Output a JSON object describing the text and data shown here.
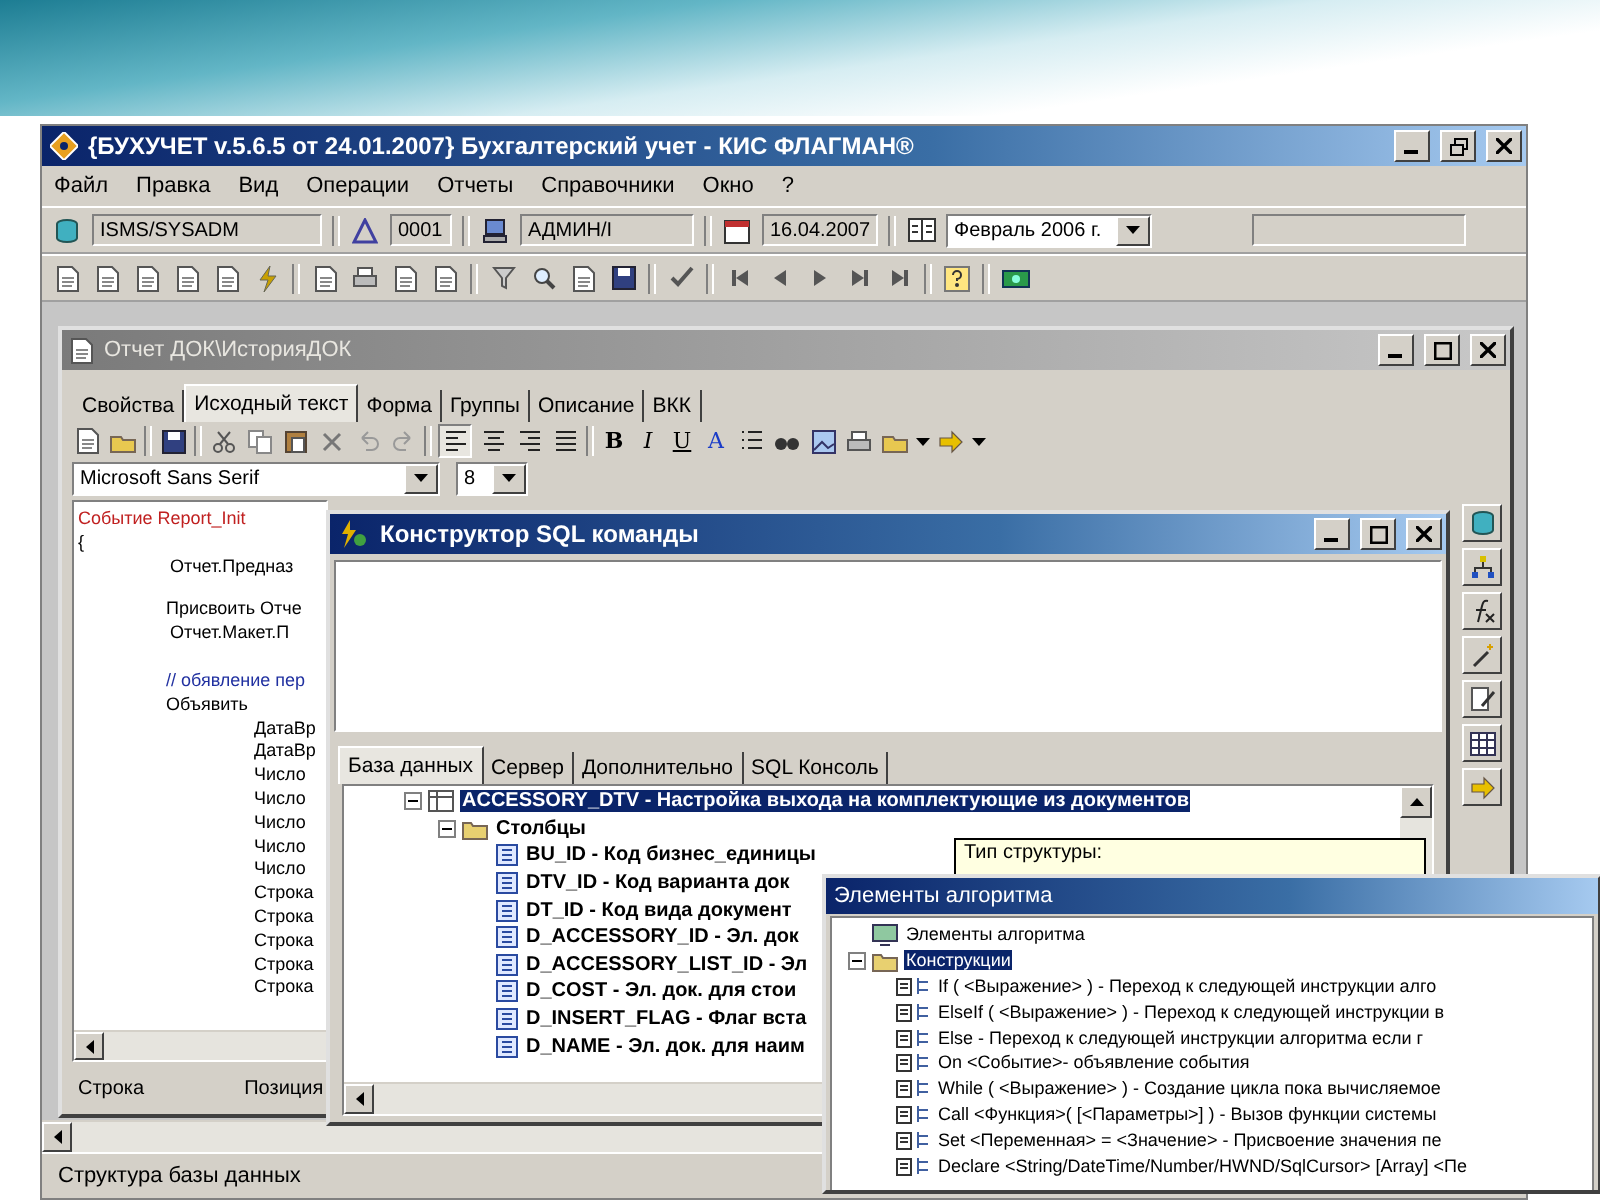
{
  "app_window": {
    "title": "{БУХУЧЕТ v.5.6.5 от 24.01.2007} Бухгалтерский учет - КИС ФЛАГМАН®",
    "menu": [
      "Файл",
      "Правка",
      "Вид",
      "Операции",
      "Отчеты",
      "Справочники",
      "Окно",
      "?"
    ],
    "toolbar_fields": [
      "ISMS/SYSADM",
      "0001",
      "АДМИН/I",
      "16.04.2007"
    ],
    "period_select": "Февраль 2006 г.",
    "status_bar": "Структура базы данных"
  },
  "report_window": {
    "title": "Отчет ДОК\\ИсторияДОК",
    "tabs": [
      {
        "label": "Свойства",
        "selected": false
      },
      {
        "label": "Исходный текст",
        "selected": true
      },
      {
        "label": "Форма",
        "selected": false
      },
      {
        "label": "Группы",
        "selected": false
      },
      {
        "label": "Описание",
        "selected": false
      },
      {
        "label": "ВКК",
        "selected": false
      }
    ],
    "format_buttons": [
      {
        "label": "B",
        "kind": "bold"
      },
      {
        "label": "I",
        "kind": "italic"
      },
      {
        "label": "U",
        "kind": "underline"
      },
      {
        "label": "A",
        "kind": "color"
      }
    ],
    "font": "Microsoft Sans Serif",
    "font_size": "8",
    "code_lines": [
      {
        "kind": "event",
        "text": "Событие Report_Init"
      },
      {
        "kind": "brace",
        "text": "{"
      },
      {
        "kind": "call",
        "text": "Отчет.Предназ"
      },
      {
        "kind": "assign",
        "text": "Присвоить Отче"
      },
      {
        "kind": "call",
        "text": "Отчет.Макет.П"
      },
      {
        "kind": "comment",
        "text": "// обявление пер"
      },
      {
        "kind": "declare",
        "text": "Объявить"
      },
      {
        "kind": "var",
        "text": "ДатаВр"
      },
      {
        "kind": "var",
        "text": "ДатаВр"
      },
      {
        "kind": "var",
        "text": "Число"
      },
      {
        "kind": "var",
        "text": "Число"
      },
      {
        "kind": "var",
        "text": "Число"
      },
      {
        "kind": "var",
        "text": "Число"
      },
      {
        "kind": "var",
        "text": "Число"
      },
      {
        "kind": "var",
        "text": "Строка"
      },
      {
        "kind": "var",
        "text": "Строка"
      },
      {
        "kind": "var",
        "text": "Строка"
      },
      {
        "kind": "var",
        "text": "Строка"
      },
      {
        "kind": "var",
        "text": "Строка"
      }
    ],
    "status": [
      "Строка",
      "Позиция"
    ]
  },
  "sql_dialog": {
    "title": "Конструктор SQL команды",
    "tabs": [
      {
        "label": "База данных",
        "selected": true
      },
      {
        "label": "Сервер",
        "selected": false
      },
      {
        "label": "Дополнительно",
        "selected": false
      },
      {
        "label": "SQL Консоль",
        "selected": false
      }
    ],
    "tree": [
      {
        "kind": "table",
        "label": "ACCESSORY_DTV - Настройка выхода на комплектующие из документов",
        "selected": true,
        "expanded": true,
        "children": [
          {
            "kind": "folder",
            "label": "Столбцы",
            "selected": false,
            "expanded": true,
            "children": [
              {
                "kind": "column",
                "label": "BU_ID - Код бизнес_единицы",
                "selected": false
              },
              {
                "kind": "column",
                "label": "DTV_ID - Код варианта док",
                "selected": false
              },
              {
                "kind": "column",
                "label": "DT_ID - Код вида документ",
                "selected": false
              },
              {
                "kind": "column",
                "label": "D_ACCESSORY_ID - Эл. док",
                "selected": false
              },
              {
                "kind": "column",
                "label": "D_ACCESSORY_LIST_ID - Эл",
                "selected": false
              },
              {
                "kind": "column",
                "label": "D_COST - Эл. док. для стои",
                "selected": false
              },
              {
                "kind": "column",
                "label": "D_INSERT_FLAG - Флаг вста",
                "selected": false
              },
              {
                "kind": "column",
                "label": "D_NAME - Эл. док. для наим",
                "selected": false
              }
            ]
          }
        ]
      }
    ],
    "tooltip": "Тип структуры:"
  },
  "algorithm_window": {
    "title": "Элементы алгоритма",
    "tree": [
      {
        "kind": "root",
        "label": "Элементы алгоритма",
        "selected": false
      },
      {
        "kind": "folder",
        "label": "Конструкции",
        "selected": true,
        "expanded": true,
        "children": [
          {
            "kind": "construct",
            "label": "If ( <Выражение> ) - Переход к следующей инструкции алго",
            "selected": false
          },
          {
            "kind": "construct",
            "label": "ElseIf ( <Выражение> ) - Переход к следующей инструкции в",
            "selected": false
          },
          {
            "kind": "construct",
            "label": "Else - Переход к следующей инструкции алгоритма если г",
            "selected": false
          },
          {
            "kind": "construct",
            "label": "On <Событие>- объявление события",
            "selected": false
          },
          {
            "kind": "construct",
            "label": "While ( <Выражение> ) - Создание цикла пока вычисляемое",
            "selected": false
          },
          {
            "kind": "construct",
            "label": "Call <Функция>( [<Параметры>] ) - Вызов функции системы",
            "selected": false
          },
          {
            "kind": "construct",
            "label": "Set <Переменная> = <Значение> - Присвоение значения пе",
            "selected": false
          },
          {
            "kind": "construct",
            "label": "Declare <String/DateTime/Number/HWND/SqlCursor> [Array] <Пе",
            "selected": false
          }
        ]
      }
    ]
  }
}
